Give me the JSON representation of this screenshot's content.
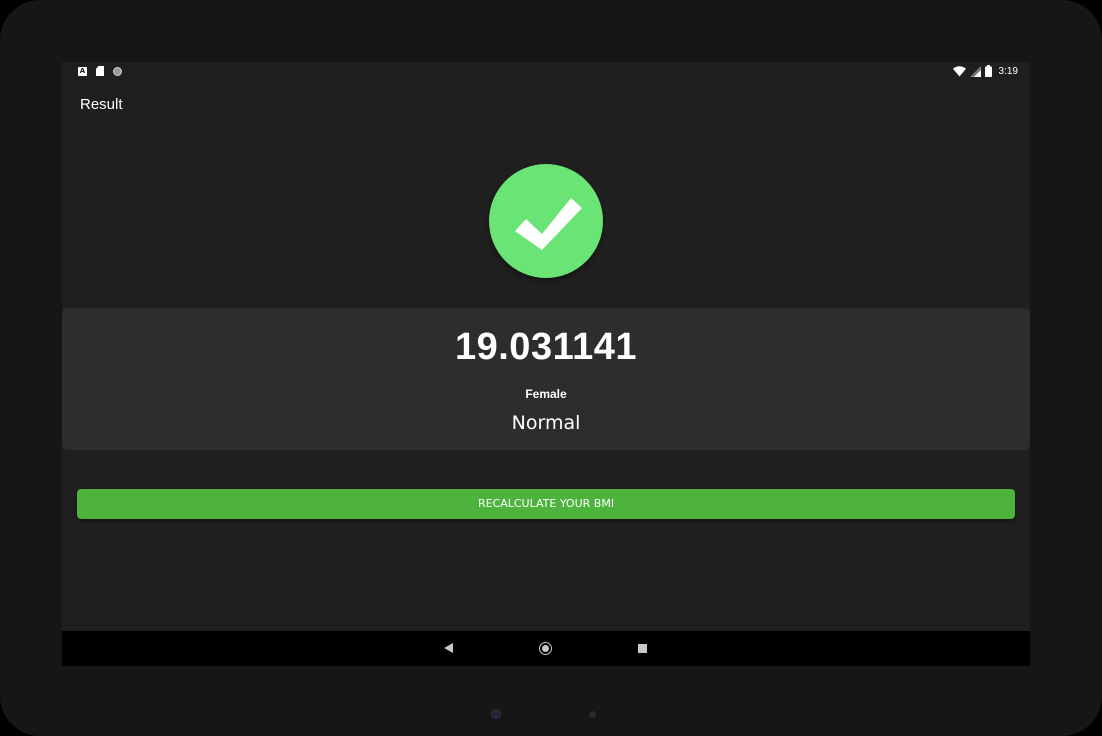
{
  "status_bar": {
    "notification_icons": [
      "a-icon",
      "sd-card-icon",
      "sync-circle-icon"
    ],
    "time": "3:19",
    "system_icons": [
      "wifi-icon",
      "signal-icon",
      "battery-icon"
    ]
  },
  "app_bar": {
    "title": "Result"
  },
  "result": {
    "status_icon": "check-circle-icon",
    "bmi_value": "19.031141",
    "gender": "Female",
    "category": "Normal"
  },
  "actions": {
    "recalculate_label": "RECALCULATE YOUR BMI"
  },
  "navigation": {
    "buttons": [
      "back-icon",
      "home-icon",
      "recents-icon"
    ]
  },
  "colors": {
    "screen_background": "#1f1f1f",
    "card_background": "#2d2d2d",
    "check_circle": "#69e475",
    "button_background": "#4db33d",
    "text": "#ffffff"
  }
}
